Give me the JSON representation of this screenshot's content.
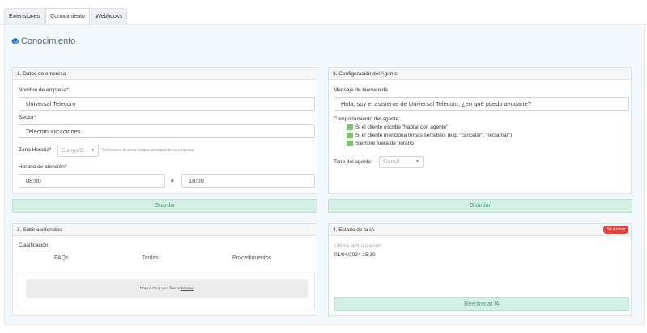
{
  "tabs": [
    {
      "label": "Extensiones",
      "active": false
    },
    {
      "label": "Conocimiento",
      "active": true
    },
    {
      "label": "Webhooks",
      "active": false
    }
  ],
  "page": {
    "title": "Conocimiento",
    "icon": "brain-icon"
  },
  "empresa": {
    "header": "1. Datos de empresa",
    "name_label": "Nombre de empresa*",
    "name_value": "Universal Telecom",
    "sector_label": "Sector*",
    "sector_value": "Telecomunicaciones",
    "zona_label": "Zona Horaria*",
    "zona_value": "Europe/Z...",
    "zona_hint": "Seleccione la zona horaria principal de su empresa",
    "horario_label": "Horario de atención*",
    "hora_inicio": "08:00",
    "separator": "a",
    "hora_fin": "18:00",
    "save_label": "Guardar"
  },
  "agente": {
    "header": "2. Configuración del Agente",
    "welcome_label": "Mensaje de bienvenida",
    "welcome_value": "Hola, soy el asistente de Universal Telecom, ¿en qué puedo ayudarte?",
    "behavior_label": "Comportamiento del agente:",
    "behaviors": [
      "Si el cliente escribe \"hablar con agente\"",
      "Si el cliente menciona temas sensibles (e.g. \"cancelar\", \"reclamar\")",
      "Siempre fuera de horario"
    ],
    "tone_label": "Tono del agente",
    "tone_value": "Formal",
    "save_label": "Guardar"
  },
  "contenidos": {
    "header": "3. Subir contenidos",
    "class_label": "Clasificación:",
    "categories": [
      "FAQs",
      "Tarifas",
      "Procedimientos"
    ],
    "drop_text": "Drag & Drop your files or",
    "browse": "Browse"
  },
  "ia": {
    "header": "4. Estado de la IA",
    "status": "No Activo",
    "status_color": "#e8453a",
    "updated_label": "Última actualización:",
    "updated_value": "01/04/2024 15:30",
    "retrain_label": "Reentrenar IA"
  }
}
